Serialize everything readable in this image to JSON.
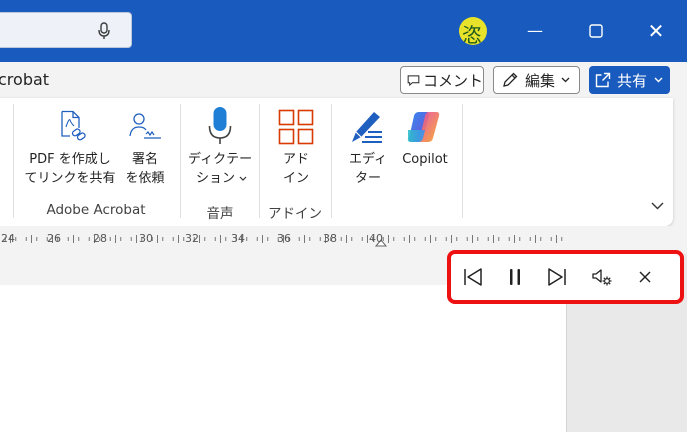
{
  "titlebar": {
    "bg_color": "#185abd",
    "search_icon": "microphone-icon",
    "avatar_glyph": "恣",
    "minimize": "—",
    "maximize": "☐",
    "close": "✕"
  },
  "tabs": {
    "partial_tab": "crobat"
  },
  "topbar": {
    "comment_label": "コメント",
    "edit_label": "編集",
    "share_label": "共有"
  },
  "ribbon": {
    "pdf_line1": "PDF を作成し",
    "pdf_line2": "てリンクを共有",
    "sign_line1": "署名",
    "sign_line2": "を依頼",
    "group_adobe": "Adobe Acrobat",
    "dictate_line1": "ディクテー",
    "dictate_line2": "ション",
    "group_voice": "音声",
    "addin_line1": "アド",
    "addin_line2": "イン",
    "group_addin": "アドイン",
    "editor_line1": "エディ",
    "editor_line2": "ター",
    "copilot_label": "Copilot"
  },
  "ruler": {
    "numbers": [
      "24",
      "26",
      "28",
      "30",
      "32",
      "34",
      "36",
      "38",
      "40"
    ]
  },
  "read_aloud": {
    "highlight_color": "#ee1111",
    "buttons": [
      "previous-icon",
      "pause-icon",
      "next-icon",
      "voice-settings-icon",
      "close-icon"
    ]
  }
}
